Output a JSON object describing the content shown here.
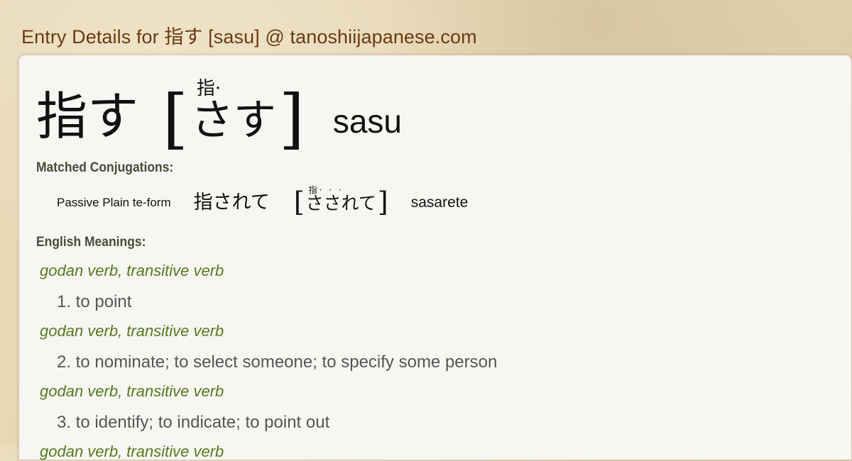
{
  "site_title": "Entry Details for 指す [sasu] @ tanoshiijapanese.com",
  "entry": {
    "headword": "指す",
    "reading_ruby": "指·",
    "reading_kana": "さす",
    "bracket_open": "[",
    "bracket_close": "]",
    "romaji": "sasu"
  },
  "conjugations": {
    "label": "Matched Conjugations:",
    "items": [
      {
        "form": "Passive Plain te-form",
        "kanji": "指されて",
        "ruby": "指· · ·",
        "kana": "さされて",
        "romaji": "sasarete"
      }
    ]
  },
  "meanings": {
    "label": "English Meanings:",
    "items": [
      {
        "pos": "godan verb, transitive verb",
        "text": "1. to point"
      },
      {
        "pos": "godan verb, transitive verb",
        "text": "2. to nominate; to select someone; to specify some person"
      },
      {
        "pos": "godan verb, transitive verb",
        "text": "3. to identify; to indicate; to point out"
      },
      {
        "pos": "godan verb, transitive verb",
        "text": ""
      }
    ]
  },
  "colors": {
    "title": "#6b3a12",
    "pos": "#557a1f",
    "meaning": "#555555",
    "panel": "#f7f6f2"
  }
}
